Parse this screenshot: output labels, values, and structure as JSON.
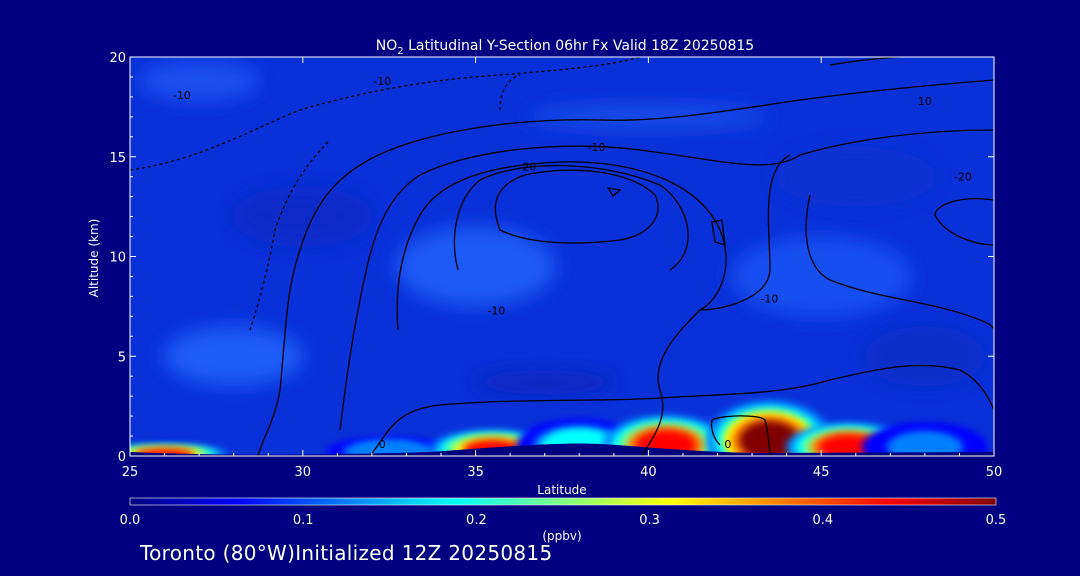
{
  "chart_data": {
    "type": "heatmap",
    "title_prefix": "NO",
    "title_subscript": "2",
    "title_suffix": " Latitudinal Y-Section 06hr  Fx Valid 18Z 20250815",
    "xlabel": "Latitude",
    "ylabel": "Altitude (km)",
    "xlim": [
      25,
      50
    ],
    "ylim": [
      0,
      20
    ],
    "x_ticks": [
      "25",
      "30",
      "35",
      "40",
      "45",
      "50"
    ],
    "y_ticks": [
      "0",
      "5",
      "10",
      "15",
      "20"
    ],
    "colorbar": {
      "label": "(ppbv)",
      "range": [
        0.0,
        0.5
      ],
      "ticks": [
        "0.0",
        "0.1",
        "0.2",
        "0.3",
        "0.4",
        "0.5"
      ],
      "colormap": [
        "#00007f",
        "#0000ff",
        "#0080ff",
        "#00ffff",
        "#80ff80",
        "#ffff00",
        "#ff8000",
        "#ff0000",
        "#800000"
      ]
    },
    "background_value": 0.02,
    "no2_plumes": [
      {
        "lat": 26.0,
        "alt": 0.2,
        "value": 0.42
      },
      {
        "lat": 32.5,
        "alt": 0.4,
        "value": 0.15
      },
      {
        "lat": 35.5,
        "alt": 0.6,
        "value": 0.42
      },
      {
        "lat": 38.0,
        "alt": 0.9,
        "value": 0.2
      },
      {
        "lat": 40.5,
        "alt": 1.0,
        "value": 0.45
      },
      {
        "lat": 43.5,
        "alt": 1.4,
        "value": 0.5
      },
      {
        "lat": 45.8,
        "alt": 0.8,
        "value": 0.45
      },
      {
        "lat": 48.0,
        "alt": 0.8,
        "value": 0.14
      }
    ],
    "temperature_contours": {
      "labels": [
        {
          "text": "-10",
          "lat": 26.5,
          "alt": 17.9
        },
        {
          "text": "-10",
          "lat": 32.3,
          "alt": 18.6
        },
        {
          "text": "0",
          "lat": 47.2,
          "alt": 20.0
        },
        {
          "text": "-10",
          "lat": 38.5,
          "alt": 15.3
        },
        {
          "text": "-20",
          "lat": 36.5,
          "alt": 14.3
        },
        {
          "text": "10",
          "lat": 48.0,
          "alt": 17.6
        },
        {
          "text": "-20",
          "lat": 49.1,
          "alt": 13.8
        },
        {
          "text": "-10",
          "lat": 43.5,
          "alt": 7.7
        },
        {
          "text": "-10",
          "lat": 35.6,
          "alt": 7.1
        },
        {
          "text": "0",
          "lat": 32.3,
          "alt": 0.4
        },
        {
          "text": "0",
          "lat": 42.3,
          "alt": 0.4
        }
      ]
    }
  },
  "footer": {
    "text": "Toronto (80°W)Initialized 12Z 20250815"
  }
}
